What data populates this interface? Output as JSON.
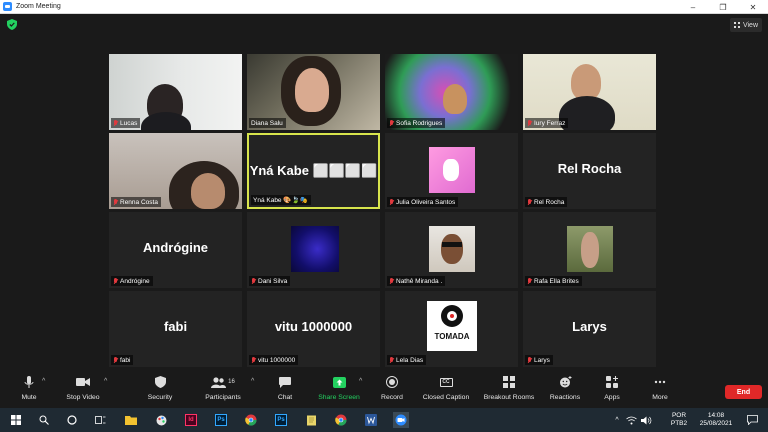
{
  "window": {
    "title": "Zoom Meeting",
    "controls": [
      "–",
      "❐",
      "✕"
    ]
  },
  "topbar": {
    "view_label": "View"
  },
  "participants": [
    {
      "name": "Lucas",
      "display": null
    },
    {
      "name": "Diana Salu",
      "display": null
    },
    {
      "name": "Sofia Rodrigues",
      "display": null
    },
    {
      "name": "Iury Ferraz",
      "display": null
    },
    {
      "name": "Renna Costa",
      "display": null
    },
    {
      "name": "Yná Kabe 🎨🍃🎭",
      "display": "Yná  Kabe ⬜⬜⬜⬜",
      "active_speaker": true
    },
    {
      "name": "Julia Oliveira Santos",
      "display": null
    },
    {
      "name": "Rel Rocha",
      "display": "Rel Rocha"
    },
    {
      "name": "Andrógine",
      "display": "Andrógine"
    },
    {
      "name": "Dani Silva",
      "display": null
    },
    {
      "name": "Nathê Miranda .",
      "display": null
    },
    {
      "name": "Rafa Ella Brites",
      "display": null
    },
    {
      "name": "fabi",
      "display": "fabi"
    },
    {
      "name": "vitu 1000000",
      "display": "vitu 1000000"
    },
    {
      "name": "Lela Dias",
      "display": null
    },
    {
      "name": "Larys",
      "display": "Larys"
    }
  ],
  "logo_text": "TOMADA",
  "toolbar": {
    "mute": "Mute",
    "stop_video": "Stop Video",
    "security": "Security",
    "participants": "Participants",
    "participants_count": "16",
    "chat": "Chat",
    "share_screen": "Share Screen",
    "record": "Record",
    "closed_caption": "Closed Caption",
    "closed_caption_icon": "CC",
    "breakout_rooms": "Breakout Rooms",
    "reactions": "Reactions",
    "apps": "Apps",
    "more": "More",
    "end": "End"
  },
  "taskbar": {
    "language": "POR",
    "layout": "PTB2",
    "time": "14:08",
    "date": "25/08/2021",
    "indesign": "Id",
    "photoshop": "Ps"
  },
  "colors": {
    "active_speaker_border": "#d7e44c",
    "share_green": "#23d160",
    "end_red": "#e02828",
    "muted_red": "#e0393e"
  }
}
